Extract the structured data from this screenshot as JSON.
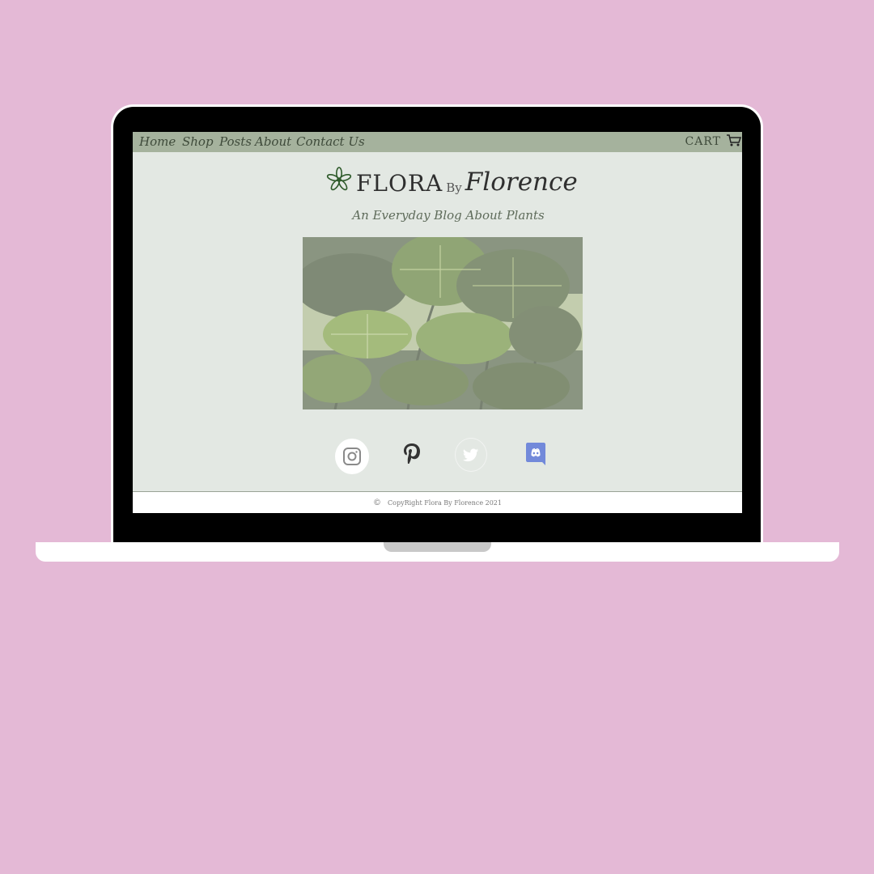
{
  "nav": {
    "links": [
      "Home",
      "Shop",
      "Posts",
      "About",
      "Contact Us"
    ],
    "cart_label": "CART",
    "cart_icon": "cart-icon"
  },
  "brand": {
    "flora": "FLORA",
    "by": "By",
    "florence": "Florence",
    "logo_icon": "flower-icon"
  },
  "tagline": "An Everyday Blog About Plants",
  "social": {
    "icons": [
      "instagram-icon",
      "pinterest-icon",
      "twitter-icon",
      "discord-icon"
    ]
  },
  "footer": {
    "copyright_symbol": "©",
    "text": "CopyRight Flora By Florence 2021"
  },
  "colors": {
    "page_background": "#e4b9d6",
    "screen_background": "#e3e8e3",
    "navbar": "#a5b29d",
    "discord": "#7289da"
  }
}
